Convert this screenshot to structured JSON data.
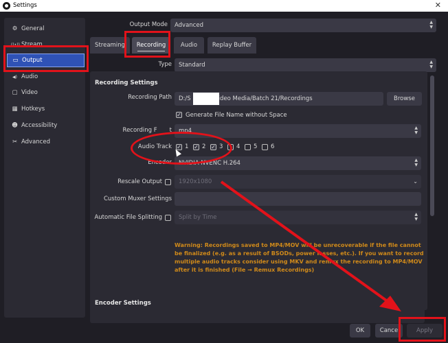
{
  "window": {
    "title": "Settings",
    "close_glyph": "✕"
  },
  "sidebar": {
    "items": [
      {
        "label": "General",
        "icon": "⚙"
      },
      {
        "label": "Stream",
        "icon": "((•))"
      },
      {
        "label": "Output",
        "icon": "▭"
      },
      {
        "label": "Audio",
        "icon": "◀)"
      },
      {
        "label": "Video",
        "icon": "▢"
      },
      {
        "label": "Hotkeys",
        "icon": "▦"
      },
      {
        "label": "Accessibility",
        "icon": "☻"
      },
      {
        "label": "Advanced",
        "icon": "✂"
      }
    ]
  },
  "output_mode": {
    "label": "Output Mode",
    "value": "Advanced"
  },
  "tabs": [
    "Streaming",
    "Recording",
    "Audio",
    "Replay Buffer"
  ],
  "type": {
    "label": "Type",
    "value": "Standard"
  },
  "recording_settings": {
    "title": "Recording Settings",
    "path_label": "Recording Path",
    "path_prefix": "D:/S",
    "path_suffix": "ideo Media/Batch 21/Recordings",
    "browse": "Browse",
    "gen_filename": "Generate File Name without Space",
    "format_label": "Recording F",
    "format_label_tail": "t",
    "format_value": "mp4",
    "audio_track_label": "Audio Track",
    "tracks": [
      {
        "n": "1",
        "checked": true
      },
      {
        "n": "2",
        "checked": true
      },
      {
        "n": "3",
        "checked": true
      },
      {
        "n": "4",
        "checked": false
      },
      {
        "n": "5",
        "checked": false
      },
      {
        "n": "6",
        "checked": false
      }
    ],
    "encoder_label": "Encoder",
    "encoder_value": "NVIDIA NVENC H.264",
    "rescale_label": "Rescale Output",
    "rescale_value": "1920x1080",
    "muxer_label": "Custom Muxer Settings",
    "split_label": "Automatic File Splitting",
    "split_value": "Split by Time",
    "warning": "Warning: Recordings saved to MP4/MOV will be unrecoverable if the file cannot be finalized (e.g. as a result of BSODs, power losses, etc.). If you want to record multiple audio tracks consider using MKV and remux the recording to MP4/MOV after it is finished (File → Remux Recordings)"
  },
  "encoder_settings": {
    "title": "Encoder Settings"
  },
  "buttons": {
    "ok": "OK",
    "cancel": "Cance",
    "apply": "Apply"
  },
  "annotation_color": "#e2121a"
}
